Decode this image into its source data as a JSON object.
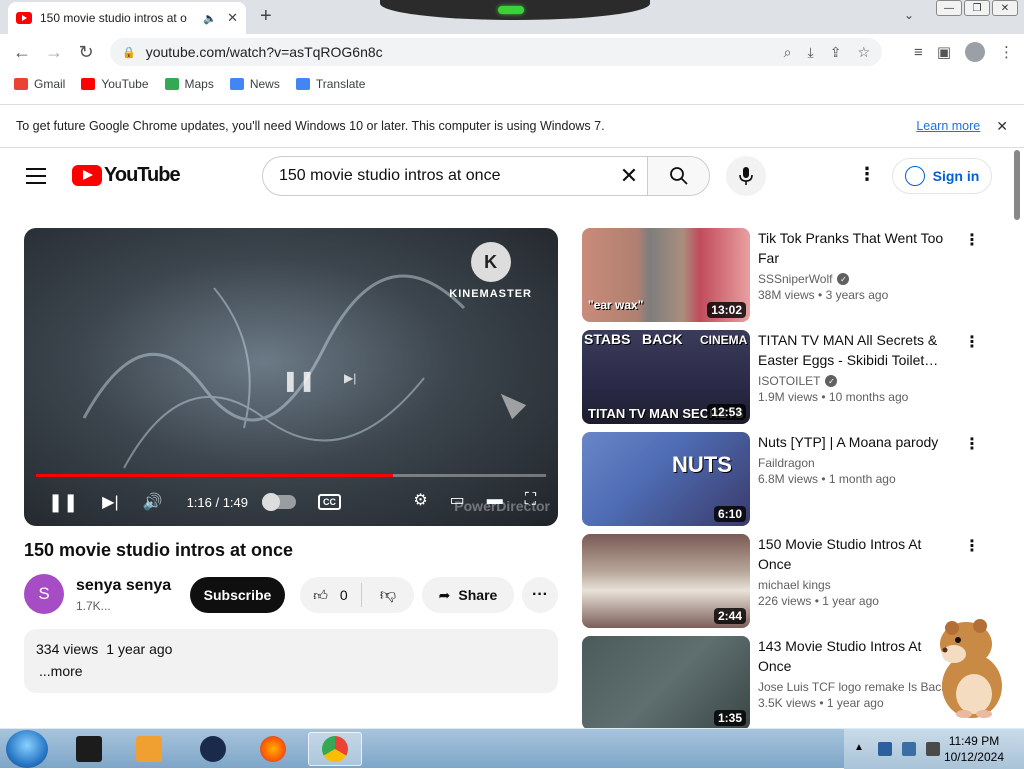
{
  "browser": {
    "tab_title": "150 movie studio intros at o",
    "audio_icon": "speaker-icon",
    "url": "youtube.com/watch?v=asTqROG6n8c"
  },
  "bookmarks": [
    {
      "label": "Gmail",
      "color": "#ea4335"
    },
    {
      "label": "YouTube",
      "color": "#ff0000"
    },
    {
      "label": "Maps",
      "color": "#34a853"
    },
    {
      "label": "News",
      "color": "#4285f4"
    },
    {
      "label": "Translate",
      "color": "#4285f4"
    }
  ],
  "infobar": {
    "message": "To get future Google Chrome updates, you'll need Windows 10 or later. This computer is using Windows 7.",
    "link": "Learn more"
  },
  "youtube": {
    "logo_text": "YouTube",
    "search_query": "150 movie studio intros at once",
    "signin_label": "Sign in"
  },
  "player": {
    "watermark_top": "KINEMASTER",
    "watermark_bottom": "PowerDirector",
    "time": "1:16 / 1:49",
    "progress": 0.7,
    "buffered": 0.93
  },
  "video": {
    "title": "150 movie studio intros at once",
    "channel_initial": "S",
    "channel_name": "senya senya",
    "subscribers": "1.7K...",
    "subscribe_label": "Subscribe",
    "likes": "0",
    "share_label": "Share",
    "views": "334 views",
    "age": "1 year ago",
    "more": "...more"
  },
  "recommendations": [
    {
      "title": "Tik Tok Pranks That Went Too Far",
      "channel": "SSSniperWolf",
      "verified": true,
      "views": "38M views",
      "age": "3 years ago",
      "duration": "13:02",
      "thumb_text": "\"ear wax\""
    },
    {
      "title": "TITAN TV MAN All Secrets & Easter Eggs - Skibidi Toilet…",
      "channel": "ISOTOILET",
      "verified": true,
      "views": "1.9M views",
      "age": "10 months ago",
      "duration": "12:53",
      "thumb_text": [
        "STABS",
        "BACK",
        "CINEMA",
        "TITAN TV MAN SECRETS"
      ]
    },
    {
      "title": "Nuts [YTP] | A Moana parody",
      "channel": "Faildragon",
      "verified": false,
      "views": "6.8M views",
      "age": "1 month ago",
      "duration": "6:10",
      "thumb_text": "NUTS"
    },
    {
      "title": "150 Movie Studio Intros At Once",
      "channel": "michael kings",
      "verified": false,
      "views": "226 views",
      "age": "1 year ago",
      "duration": "2:44"
    },
    {
      "title": "143 Movie Studio Intros At Once",
      "channel": "Jose Luis TCF logo remake Is Back",
      "verified": false,
      "views": "3.5K views",
      "age": "1 year ago",
      "duration": "1:35"
    }
  ],
  "taskbar": {
    "time": "11:49 PM",
    "date": "10/12/2024"
  }
}
